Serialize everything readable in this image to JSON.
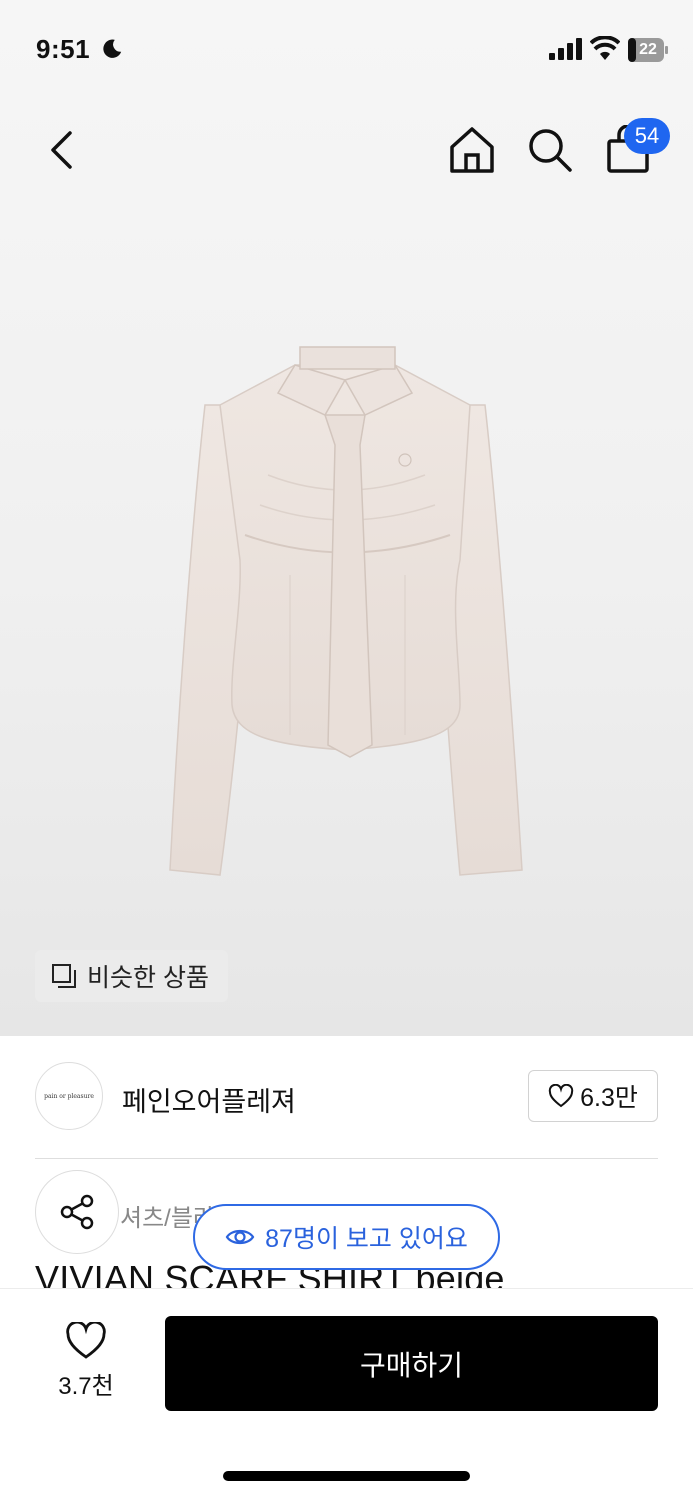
{
  "status_bar": {
    "time": "9:51",
    "battery_level": "22",
    "icons": [
      "moon-icon",
      "cellular-signal-icon",
      "wifi-icon",
      "battery-icon"
    ]
  },
  "nav": {
    "icons": [
      "back-arrow-icon",
      "home-icon",
      "search-icon",
      "shopping-bag-icon"
    ],
    "cart_badge": "54"
  },
  "product": {
    "image_alt": "beige long-sleeve shirt with scarf tie",
    "similar_button": "비슷한 상품",
    "category": "셔츠/블라우스 · 페인오어플레져",
    "title": "VIVIAN SCARF SHIRT beige"
  },
  "brand": {
    "logo_text": "pain or pleasure",
    "name": "페인오어플레져",
    "like_count": "6.3만"
  },
  "viewers": {
    "text": "87명이 보고 있어요"
  },
  "bottom_bar": {
    "wish_count": "3.7천",
    "buy_label": "구매하기"
  },
  "colors": {
    "accent_blue": "#1f66f0",
    "buy_button": "#000000",
    "hero_background": "#f0f0f0"
  }
}
